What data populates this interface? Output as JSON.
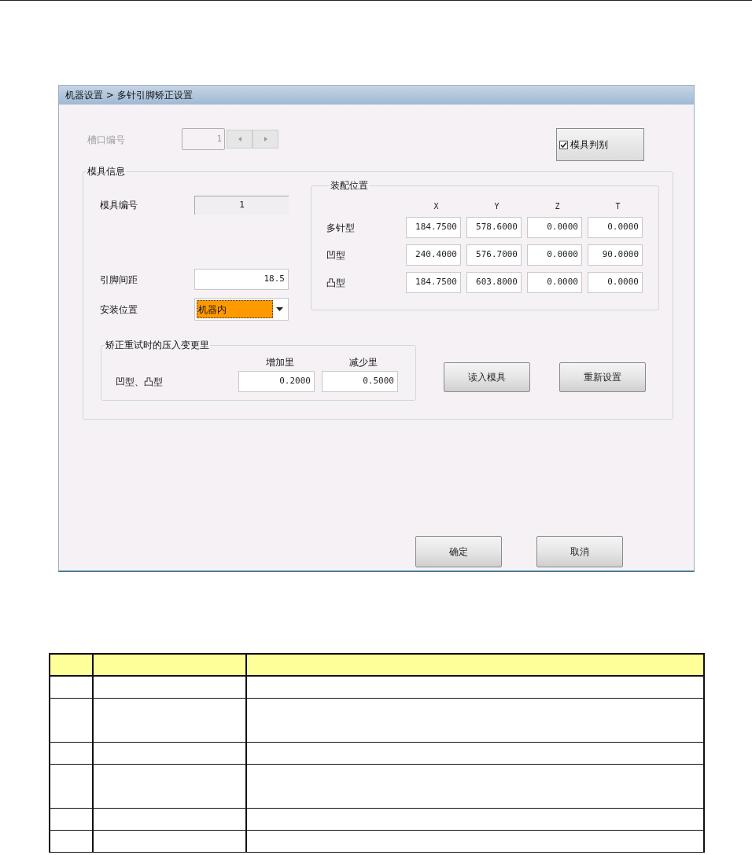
{
  "breadcrumb": "机器设置 > 多针引脚矫正设置",
  "slot": {
    "label": "槽口编号",
    "value": "1",
    "disabled": true
  },
  "mold_check": {
    "label": "模具判别",
    "checked": true
  },
  "mold_info": {
    "title": "模具信息",
    "mold_number": {
      "label": "模具编号",
      "value": "1"
    },
    "pin_pitch": {
      "label": "引脚间距",
      "value": "18.5"
    },
    "install_position": {
      "label": "安装位置",
      "value": "机器内",
      "focused": true
    }
  },
  "assembly": {
    "title": "装配位置",
    "columns": [
      "X",
      "Y",
      "Z",
      "T"
    ],
    "rows": [
      {
        "label": "多针型",
        "values": [
          "184.7500",
          "578.6000",
          "0.0000",
          "0.0000"
        ]
      },
      {
        "label": "凹型",
        "values": [
          "240.4000",
          "576.7000",
          "0.0000",
          "90.0000"
        ]
      },
      {
        "label": "凸型",
        "values": [
          "184.7500",
          "603.8000",
          "0.0000",
          "0.0000"
        ]
      }
    ]
  },
  "correction": {
    "title": "矫正重试时的压入变更里",
    "columns": [
      "增加里",
      "减少里"
    ],
    "rows": [
      {
        "label": "凹型、凸型",
        "values": [
          "0.2000",
          "0.5000"
        ]
      }
    ]
  },
  "buttons": [
    "读入模具",
    "重新设置"
  ],
  "footer_buttons": [
    "确定",
    "取消"
  ]
}
